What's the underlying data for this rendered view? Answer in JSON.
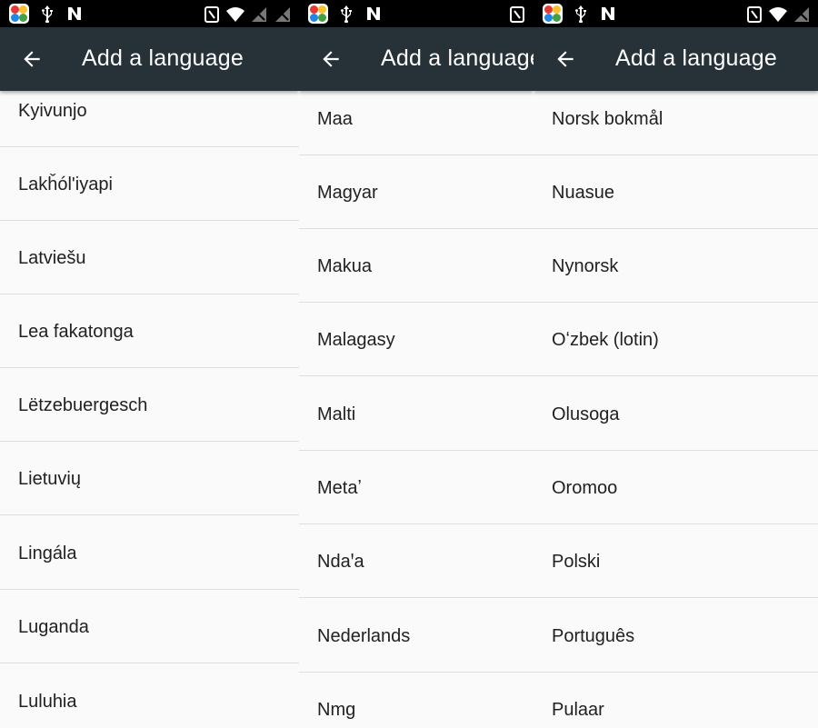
{
  "panels": [
    {
      "title": "Add a language",
      "items": [
        "Kyivunjo",
        "Lakȟól'iyapi",
        "Latviešu",
        "Lea fakatonga",
        "Lëtzebuergesch",
        "Lietuvių",
        "Lingála",
        "Luganda",
        "Luluhia"
      ]
    },
    {
      "title": "Add a language",
      "items": [
        "Maa",
        "Magyar",
        "Makua",
        "Malagasy",
        "Malti",
        "Metaʼ",
        "Ndaꞌa",
        "Nederlands",
        "Nmg"
      ]
    },
    {
      "title": "Add a language",
      "items": [
        "Norsk bokmål",
        "Nuasue",
        "Nynorsk",
        "Oʻzbek (lotin)",
        "Olusoga",
        "Oromoo",
        "Polski",
        "Português",
        "Pulaar"
      ]
    }
  ],
  "icons": {
    "back": "arrow-back-icon",
    "app": "app-launcher-icon",
    "usb": "usb-icon",
    "n": "n-notification-icon",
    "nfc": "nfc-icon",
    "wifi": "wifi-icon",
    "signal": "no-signal-icon"
  },
  "colors": {
    "toolbar": "#263238",
    "statusbar": "#000000",
    "background": "#fafafa",
    "divider": "#dedede",
    "text": "#212121"
  }
}
